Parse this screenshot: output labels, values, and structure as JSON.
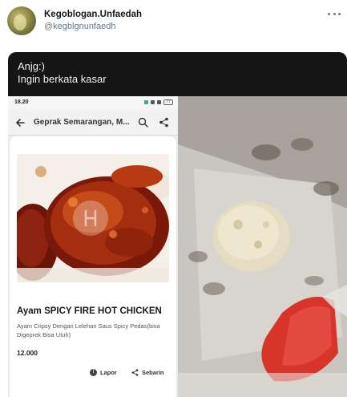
{
  "tweet": {
    "display_name": "Kegoblogan.Unfaedah",
    "handle": "@kegblgnunfaedh"
  },
  "media": {
    "caption_lines": [
      "Anjg:)",
      "Ingin berkata kasar"
    ],
    "screenshot": {
      "status_time": "18.20",
      "battery": "77",
      "store_title": "Geprak Semarangan, M...",
      "product_name": "Ayam SPICY FIRE HOT CHICKEN",
      "product_description": "Ayam Cripsy Dengan Lelehan Saus Spicy Pedas(bisa Digeprek Bisa Utuh)",
      "price": "12.000",
      "report_label": "Lapor",
      "share_label": "Sebarin"
    }
  },
  "icons": [
    "more-icon",
    "back-icon",
    "search-icon",
    "share-icon",
    "info-icon",
    "share-small-icon"
  ]
}
